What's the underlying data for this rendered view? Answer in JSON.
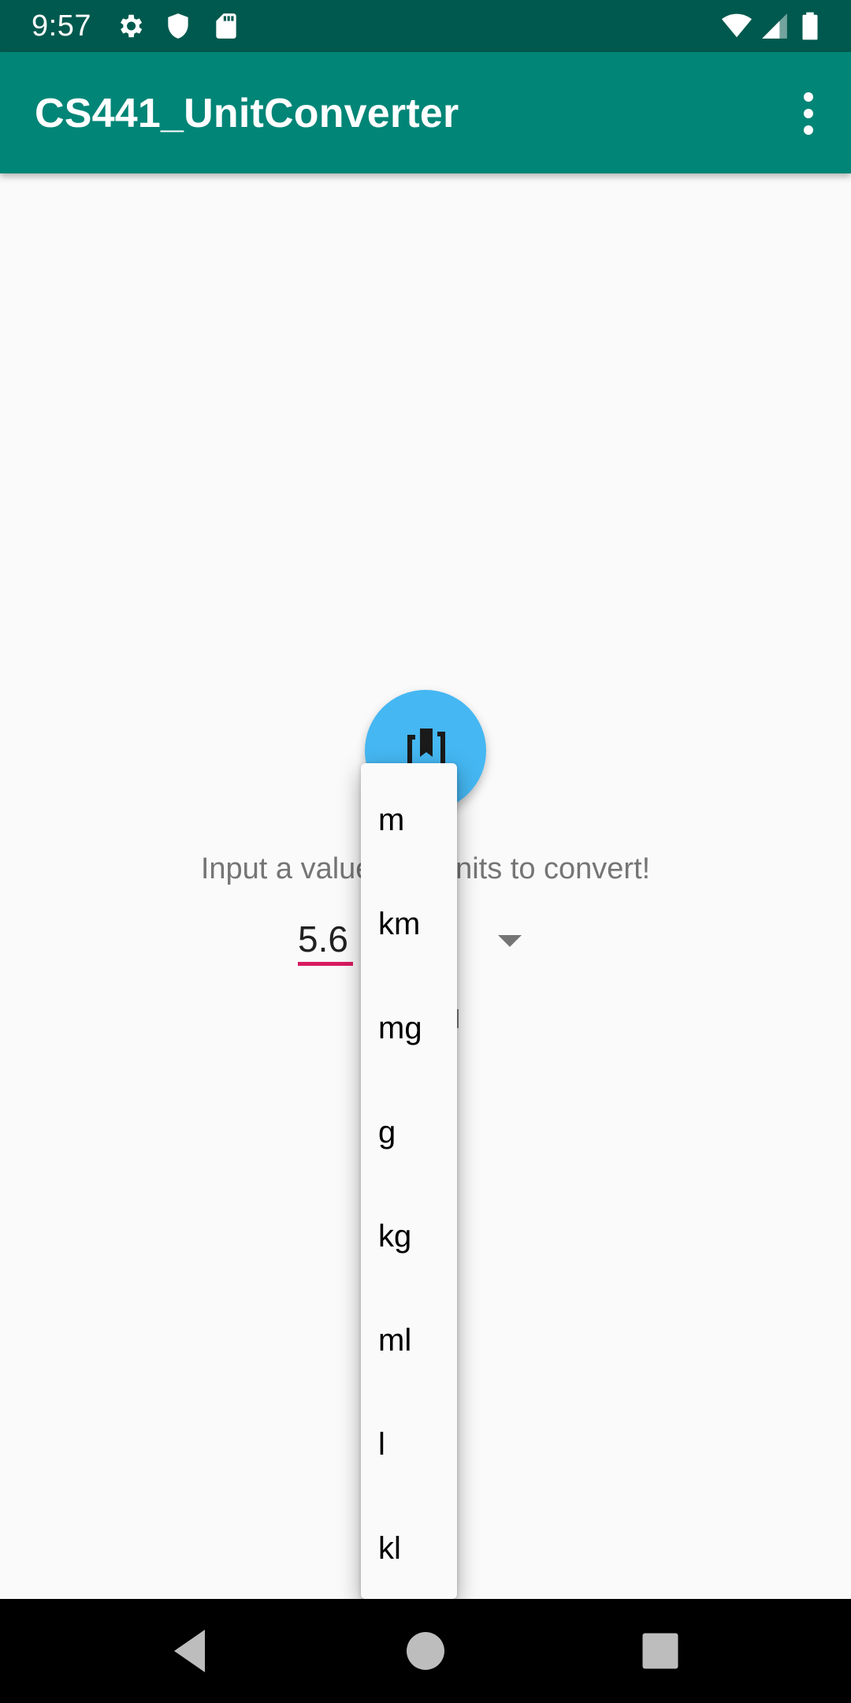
{
  "status_bar": {
    "time": "9:57",
    "icons_left": [
      "gear-icon",
      "shield-icon",
      "sd-card-icon"
    ],
    "icons_right": [
      "wifi-icon",
      "signal-icon",
      "battery-icon"
    ]
  },
  "app_bar": {
    "title": "CS441_UnitConverter",
    "menu_icon": "more-vert-icon"
  },
  "main": {
    "fab_icon": "convert-icon",
    "prompt": "Input a value and units to convert!",
    "value_input": "5.6",
    "unit_options": [
      "m",
      "km",
      "mg",
      "g",
      "kg",
      "ml",
      "l",
      "kl"
    ]
  },
  "nav_bar": {
    "buttons": [
      "back-icon",
      "home-icon",
      "recents-icon"
    ]
  },
  "colors": {
    "status_bar": "#00594e",
    "app_bar": "#008577",
    "fab": "#45b7f2",
    "accent": "#d81b60"
  }
}
